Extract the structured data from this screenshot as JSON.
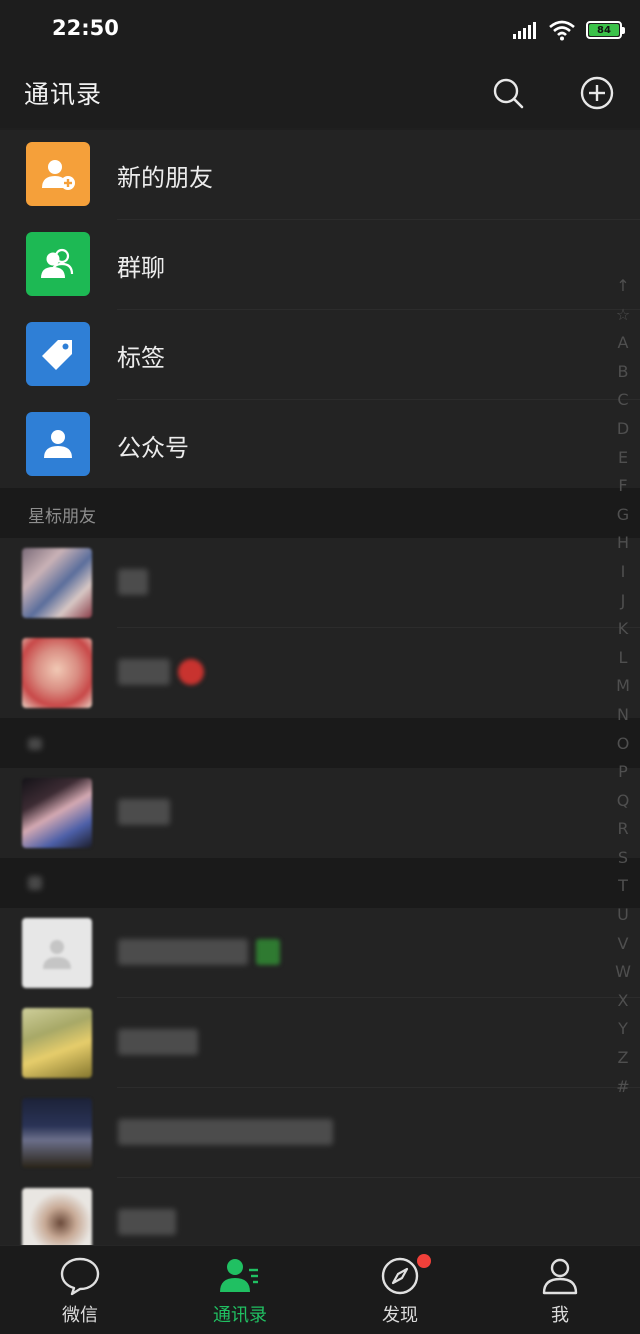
{
  "status_bar": {
    "time": "22:50",
    "battery": "84"
  },
  "header": {
    "title": "通讯录",
    "icons": [
      "search-icon",
      "add-icon"
    ]
  },
  "features": [
    {
      "label": "新的朋友",
      "icon": "add-friend-icon",
      "color": "#f5a03a"
    },
    {
      "label": "群聊",
      "icon": "group-chat-icon",
      "color": "#1db954"
    },
    {
      "label": "标签",
      "icon": "tag-icon",
      "color": "#2f7fd6"
    },
    {
      "label": "公众号",
      "icon": "official-account-icon",
      "color": "#2f7fd6"
    }
  ],
  "sections": [
    {
      "label": "星标朋友"
    },
    {
      "label": ""
    },
    {
      "label": ""
    }
  ],
  "index_letters": [
    "↑",
    "☆",
    "A",
    "B",
    "C",
    "D",
    "E",
    "F",
    "G",
    "H",
    "I",
    "J",
    "K",
    "L",
    "M",
    "N",
    "O",
    "P",
    "Q",
    "R",
    "S",
    "T",
    "U",
    "V",
    "W",
    "X",
    "Y",
    "Z",
    "#"
  ],
  "tabs": [
    {
      "label": "微信",
      "icon": "chat-icon",
      "active": false
    },
    {
      "label": "通讯录",
      "icon": "contacts-icon",
      "active": true
    },
    {
      "label": "发现",
      "icon": "discover-compass-icon",
      "active": false,
      "badge": true
    },
    {
      "label": "我",
      "icon": "me-icon",
      "active": false
    }
  ],
  "colors": {
    "accent": "#20c062",
    "background": "#1f1f1f",
    "row": "#232323",
    "section": "#1a1a1a"
  }
}
